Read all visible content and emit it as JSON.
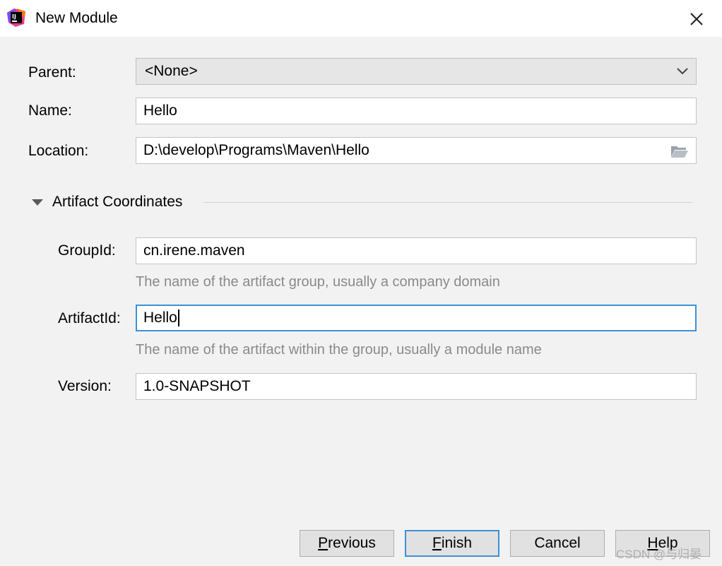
{
  "window": {
    "title": "New Module",
    "close_icon": "close-icon",
    "app_icon": "intellij-idea-icon"
  },
  "form": {
    "parent": {
      "label": "Parent:",
      "value": "<None>"
    },
    "name": {
      "label": "Name:",
      "value": "Hello"
    },
    "location": {
      "label": "Location:",
      "value": "D:\\develop\\Programs\\Maven\\Hello",
      "icon": "folder-icon"
    }
  },
  "artifact": {
    "section_label": "Artifact Coordinates",
    "expanded": true,
    "group_id": {
      "label": "GroupId:",
      "value": "cn.irene.maven",
      "hint": "The name of the artifact group, usually a company domain"
    },
    "artifact_id": {
      "label": "ArtifactId:",
      "value": "Hello",
      "hint": "The name of the artifact within the group, usually a module name"
    },
    "version": {
      "label": "Version:",
      "value": "1.0-SNAPSHOT"
    }
  },
  "buttons": {
    "previous": {
      "mnemonic": "P",
      "rest": "revious"
    },
    "finish": {
      "mnemonic": "F",
      "rest": "inish"
    },
    "cancel": "Cancel",
    "help": {
      "mnemonic": "H",
      "rest": "elp"
    }
  },
  "watermark": "CSDN @与归晏",
  "colors": {
    "focus_border": "#3d8fd9",
    "background": "#f2f2f2",
    "hint_text": "#8a8a8a"
  }
}
